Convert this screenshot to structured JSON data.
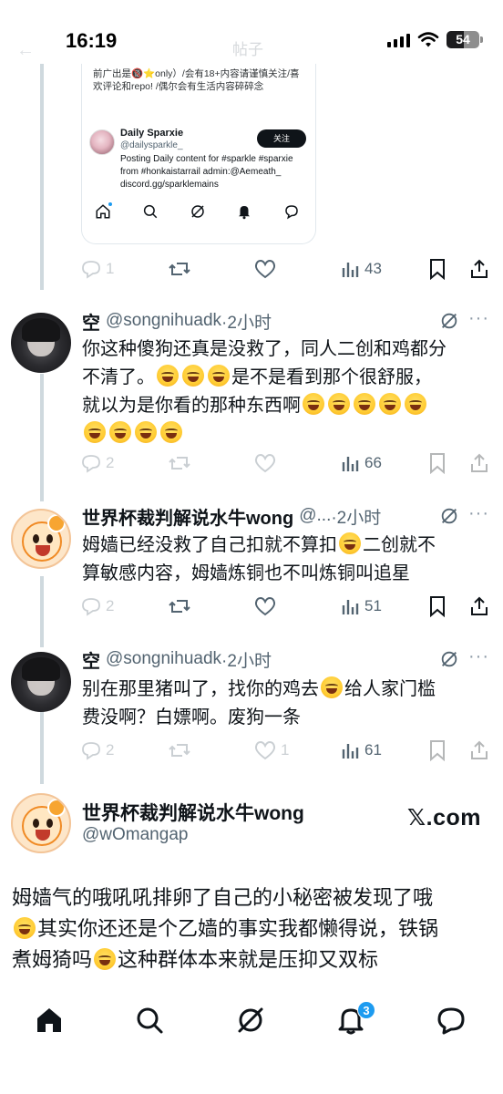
{
  "status": {
    "time": "16:19",
    "battery": "54"
  },
  "header": {
    "ghost_title": "帖子"
  },
  "quoted": {
    "top_text": "前广出是🔞⭐only）/会有18+内容请谨慎关注/喜欢评论和repo! /偶尔会有生活内容碎碎念",
    "profile": {
      "name": "Daily Sparxie",
      "handle": "@dailysparkle_",
      "follow_label": "关注",
      "bio": "Posting Daily content for #sparkle #sparxie from #honkaistarrail admin:@Aemeath_ discord.gg/sparklemains"
    },
    "nav_icons": [
      "home-icon",
      "search-icon",
      "grok-icon",
      "bell-icon",
      "message-icon"
    ]
  },
  "actions_top": {
    "replies": "1",
    "views": "43"
  },
  "tweets": [
    {
      "name": "空",
      "handle": "@songnihuadk",
      "time": "·2小时",
      "body_lines": [
        "你这种傻狗还真是没救了，同人二创和鸡都分",
        "不清了。",
        "是不是看到那个很舒服，",
        "就以为是你看的那种东西啊"
      ],
      "replies": "2",
      "views": "66"
    },
    {
      "name": "世界杯裁判解说水牛wong",
      "handle": "@...",
      "time": "·2小时",
      "body_parts": [
        "姆嫱已经没救了自己扣就不算扣",
        "二创就不",
        "算敏感内容，姆嫱炼铜也不叫炼铜叫追星"
      ],
      "replies": "2",
      "views": "51"
    },
    {
      "name": "空",
      "handle": "@songnihuadk",
      "time": "·2小时",
      "body_parts": [
        "别在那里猪叫了，找你的鸡去",
        "给人家门槛",
        "费没啊？白嫖啊。废狗一条"
      ],
      "replies": "2",
      "likes": "1",
      "views": "61"
    }
  ],
  "main_tweet": {
    "name": "世界杯裁判解说水牛wong",
    "handle": "@wOmangap",
    "source": "𝕏.com",
    "line1": "姆嫱气的哦吼吼排卵了自己的小秘密被发现了哦",
    "line2": "其实你还还是个乙嫱的事实我都懒得说，铁锅",
    "line3": "煮姆猗吗",
    "line4": "这种群体本来就是压抑又双标"
  },
  "bottom_nav": {
    "notifications_badge": "3"
  }
}
